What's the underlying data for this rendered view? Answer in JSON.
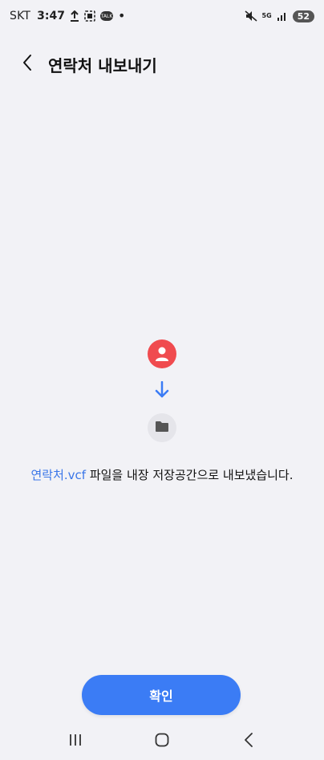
{
  "status_bar": {
    "carrier": "SKT",
    "time": "3:47",
    "talk_label": "TALK",
    "dot": "•",
    "network": "5G",
    "battery": "52"
  },
  "header": {
    "title": "연락처 내보내기"
  },
  "main": {
    "filename": "연락처.vcf",
    "message": " 파일을 내장 저장공간으로 내보냈습니다."
  },
  "footer": {
    "confirm_label": "확인"
  },
  "colors": {
    "accent": "#3b7cf5",
    "contact_icon": "#f04b4f",
    "link": "#3a76e8"
  }
}
